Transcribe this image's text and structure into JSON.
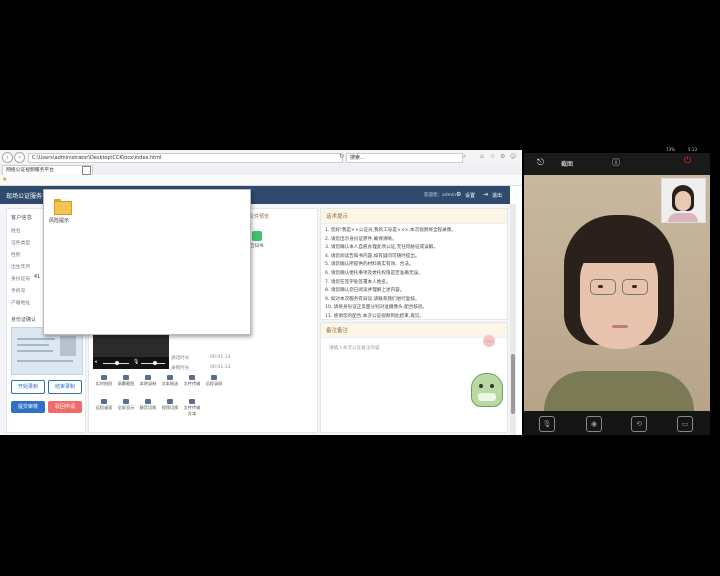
{
  "browser": {
    "url": "C:\\Users\\administrator\\Desktop\\CCK\\ocx\\index.html",
    "search_placeholder": "搜索...",
    "tab_title": "网络公证视频服务平台",
    "header_right": "设置",
    "header_right2": "退出",
    "header_user": "欢迎您：admin"
  },
  "app": {
    "title": "现场公证服务平台",
    "left_panel_title": "客户信息",
    "fields": [
      {
        "label": "姓名",
        "value": ""
      },
      {
        "label": "证件类型",
        "value": ""
      },
      {
        "label": "性别",
        "value": ""
      },
      {
        "label": "出生年月",
        "value": ""
      },
      {
        "label": "身份证号",
        "value": "41"
      },
      {
        "label": "手机号",
        "value": ""
      },
      {
        "label": "户籍地址",
        "value": ""
      }
    ],
    "card_section_title": "身份证确认",
    "buttons": {
      "transcribe": "开始录制",
      "stop": "结束录制",
      "upload": "提交审核",
      "reject": "驳回申请"
    },
    "video_info": [
      {
        "label": "通话时长",
        "value": "00:01:14"
      },
      {
        "label": "录制时长",
        "value": "00:01:12"
      }
    ],
    "tools_row1": [
      "实时拍照",
      "屏幕截图",
      "本地录制",
      "文本推送",
      "文件传输",
      "远程录屏"
    ],
    "tools_row2": [
      "远程桌面",
      "全屏显示",
      "静音切换",
      "视频切换",
      "文件传输文本"
    ],
    "middle_panel_title": "文件预览",
    "file_item_label": "告知书",
    "rules_title": "话术提示",
    "rules": [
      "1. 您好!我是××公证员,我的工号是×××,本次视频将全程录像。",
      "2. 请您出示身份证原件,确保清晰。",
      "3. 请您确认本人自愿办理此项公证,无任何胁迫或误解。",
      "4. 请您阅读告知书内容,如有疑问可随时提出。",
      "5. 请您确认所提供的材料真实有效、合法。",
      "6. 请您确认委托事项及委托权限是否准确无误。",
      "7. 请您在签字处签署本人姓名。",
      "8. 请您确认您已阅读并理解上述内容。",
      "9. 如对本次服务有异议,请联系我们进行复核。",
      "10. 请将身份证正反面分别对准摄像头,配合核验。",
      "11. 感谢您的配合,本次公证视频到此结束,再见。"
    ],
    "notes_title": "备注备注",
    "notes_placeholder": "请输入本次公证备注内容"
  },
  "popup": {
    "folder_label": "风险提示"
  },
  "phone": {
    "status_time": "5:13",
    "status_batt": "73%",
    "title": "截图",
    "bottom_icons": [
      "mic-icon",
      "camera-icon",
      "switch-camera-icon",
      "screen-share-icon"
    ]
  }
}
